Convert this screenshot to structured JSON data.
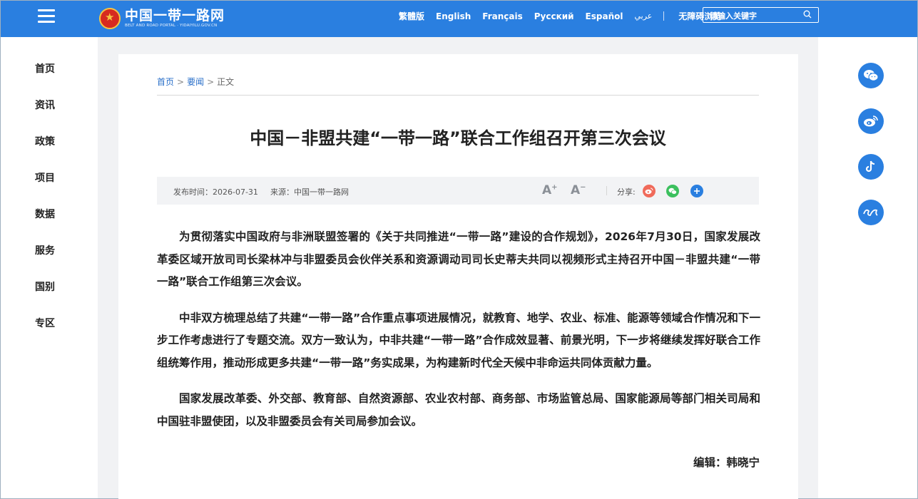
{
  "header": {
    "logo_cn": "中国一带一路网",
    "logo_en": "BELT AND ROAD PORTAL · YIDAIYILU.GOV.CN",
    "languages": [
      "繁體版",
      "English",
      "Français",
      "Русский",
      "Español",
      "عربي"
    ],
    "accessibility": "无障碍浏览",
    "search_placeholder": "请输入关键字"
  },
  "nav": {
    "items": [
      "首页",
      "资讯",
      "政策",
      "项目",
      "数据",
      "服务",
      "国别",
      "专区"
    ]
  },
  "breadcrumb": {
    "home": "首页",
    "section": "要闻",
    "sep": ">",
    "current": "正文"
  },
  "article": {
    "title": "中国－非盟共建“一带一路”联合工作组召开第三次会议",
    "publish_time": "发布时间：2026-07-31",
    "source": "来源：中国一带一路网",
    "font_increase": "A",
    "font_decrease": "A",
    "share_label": "分享:",
    "paragraphs": [
      "为贯彻落实中国政府与非洲联盟签署的《关于共同推进“一带一路”建设的合作规划》，2026年7月30日，国家发展改革委区域开放司司长梁林冲与非盟委员会伙伴关系和资源调动司司长史蒂夫共同以视频形式主持召开中国－非盟共建“一带一路”联合工作组第三次会议。",
      "中非双方梳理总结了共建“一带一路”合作重点事项进展情况，就教育、地学、农业、标准、能源等领域合作情况和下一步工作考虑进行了专题交流。双方一致认为，中非共建“一带一路”合作成效显著、前景光明，下一步将继续发挥好联合工作组统筹作用，推动形成更多共建“一带一路”务实成果，为构建新时代全天候中非命运共同体贡献力量。",
      "国家发展改革委、外交部、教育部、自然资源部、农业农村部、商务部、市场监管总局、国家能源局等部门相关司局和中国驻非盟使团，以及非盟委员会有关司局参加会议。"
    ],
    "editor": "编辑：韩晓宁"
  },
  "colors": {
    "brand_blue": "#2a7fe0",
    "weibo": "#f06a5a",
    "wechat": "#3cc05e",
    "more": "#2a7fe0"
  },
  "icons": {
    "right_panel": [
      "wechat-icon",
      "weibo-icon",
      "tiktok-icon",
      "xuexi-icon"
    ]
  }
}
